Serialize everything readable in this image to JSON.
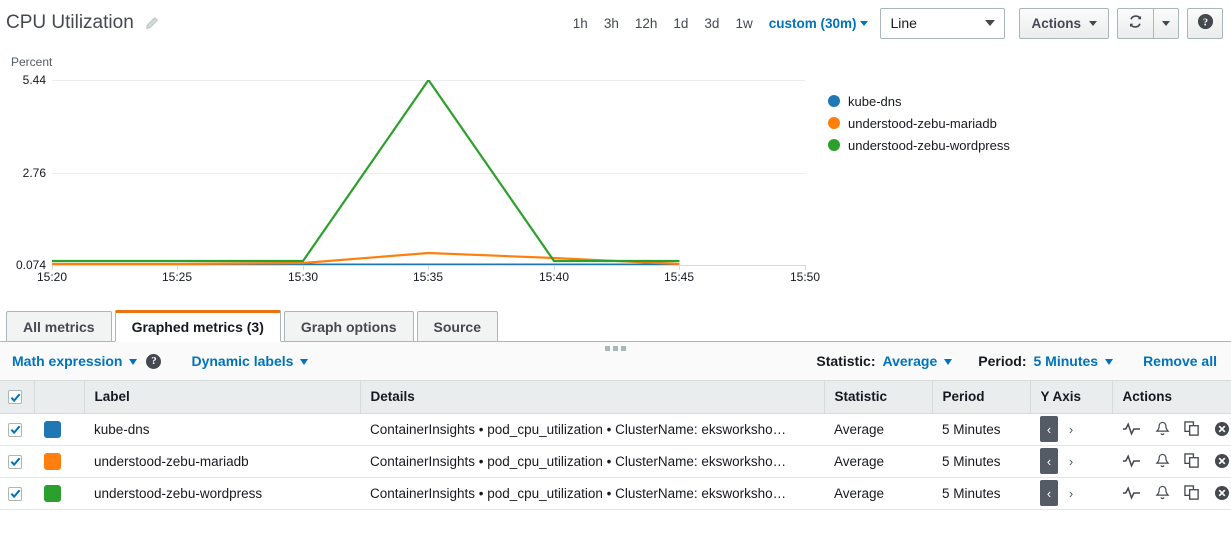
{
  "header": {
    "title": "CPU Utilization",
    "edit_icon": "pencil-icon",
    "time_ranges": [
      "1h",
      "3h",
      "12h",
      "1d",
      "3d",
      "1w"
    ],
    "custom_range": "custom (30m)",
    "graph_type": "Line",
    "actions_label": "Actions",
    "refresh_icon": "refresh-icon",
    "help_label": "?"
  },
  "chart_data": {
    "type": "line",
    "title": "CPU Utilization",
    "ylabel": "Percent",
    "xlabel": "",
    "ylim": [
      0.074,
      5.44
    ],
    "yticks": [
      0.074,
      2.76,
      5.44
    ],
    "ytick_labels": [
      "0.074",
      "2.76",
      "5.44"
    ],
    "x": [
      "15:20",
      "15:25",
      "15:30",
      "15:35",
      "15:40",
      "15:45",
      "15:50"
    ],
    "xticks": [
      "15:20",
      "15:25",
      "15:30",
      "15:35",
      "15:40",
      "15:45",
      "15:50"
    ],
    "grid": true,
    "legend_position": "right",
    "series": [
      {
        "name": "kube-dns",
        "color": "#1f77b4",
        "x": [
          "15:20",
          "15:25",
          "15:30",
          "15:35",
          "15:40",
          "15:45"
        ],
        "values": [
          0.074,
          0.074,
          0.074,
          0.074,
          0.074,
          0.074
        ]
      },
      {
        "name": "understood-zebu-mariadb",
        "color": "#ff7f0e",
        "x": [
          "15:20",
          "15:25",
          "15:30",
          "15:35",
          "15:40",
          "15:45"
        ],
        "values": [
          0.1,
          0.1,
          0.11,
          0.42,
          0.27,
          0.1
        ]
      },
      {
        "name": "understood-zebu-wordpress",
        "color": "#2ca02c",
        "x": [
          "15:20",
          "15:25",
          "15:30",
          "15:35",
          "15:40",
          "15:45"
        ],
        "values": [
          0.16,
          0.16,
          0.16,
          5.44,
          0.16,
          0.16
        ]
      }
    ]
  },
  "tabs": [
    {
      "label": "All metrics",
      "active": false
    },
    {
      "label": "Graphed metrics (3)",
      "active": true
    },
    {
      "label": "Graph options",
      "active": false
    },
    {
      "label": "Source",
      "active": false
    }
  ],
  "toolbar": {
    "math_expression": "Math expression",
    "math_help_icon": "help-icon",
    "dynamic_labels": "Dynamic labels",
    "statistic_label": "Statistic:",
    "statistic_value": "Average",
    "period_label": "Period:",
    "period_value": "5 Minutes",
    "remove_all": "Remove all"
  },
  "table": {
    "columns": [
      "",
      "",
      "Label",
      "Details",
      "Statistic",
      "Period",
      "Y Axis",
      "Actions"
    ],
    "header_checkbox_checked": true,
    "rows": [
      {
        "checked": true,
        "color": "#1f77b4",
        "label": "kube-dns",
        "details": "ContainerInsights • pod_cpu_utilization • ClusterName: eksworksho…",
        "statistic": "Average",
        "period": "5 Minutes",
        "y_axis_left": "‹",
        "y_axis_right": "›"
      },
      {
        "checked": true,
        "color": "#ff7f0e",
        "label": "understood-zebu-mariadb",
        "details": "ContainerInsights • pod_cpu_utilization • ClusterName: eksworksho…",
        "statistic": "Average",
        "period": "5 Minutes",
        "y_axis_left": "‹",
        "y_axis_right": "›"
      },
      {
        "checked": true,
        "color": "#2ca02c",
        "label": "understood-zebu-wordpress",
        "details": "ContainerInsights • pod_cpu_utilization • ClusterName: eksworksho…",
        "statistic": "Average",
        "period": "5 Minutes",
        "y_axis_left": "‹",
        "y_axis_right": "›"
      }
    ],
    "action_icons": [
      "pulse-icon",
      "bell-icon",
      "duplicate-icon",
      "remove-icon"
    ]
  }
}
